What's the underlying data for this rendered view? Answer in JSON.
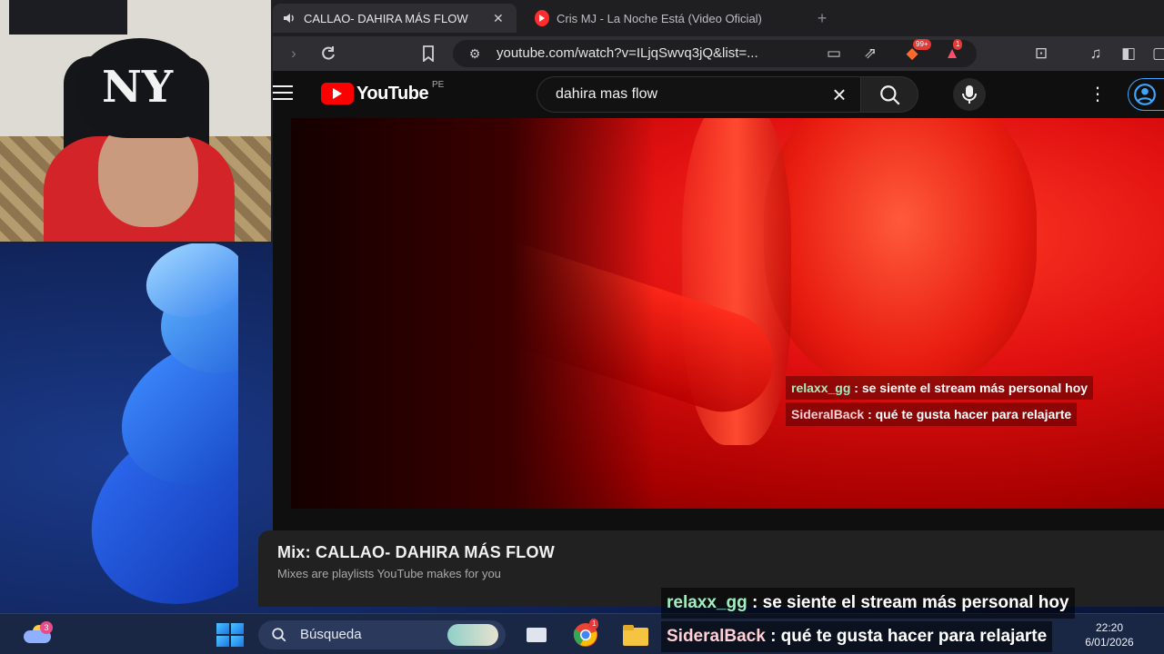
{
  "browser": {
    "tabs": [
      {
        "title": "CALLAO- DAHIRA MÁS FLOW",
        "active": true
      },
      {
        "title": "Cris MJ - La Noche Está (Video Oficial)",
        "active": false
      }
    ],
    "url": "youtube.com/watch?v=ILjqSwvq3jQ&list=...",
    "brave_badge": "99+",
    "ext_badge": "1"
  },
  "youtube": {
    "logo_text": "YouTube",
    "region": "PE",
    "search_query": "dahira mas flow"
  },
  "video_chat": [
    {
      "user": "relaxx_gg",
      "message": ": se siente el stream más personal hoy"
    },
    {
      "user": "SideralBack",
      "message": ": qué te gusta hacer para relajarte"
    }
  ],
  "playlist": {
    "title": "Mix: CALLAO- DAHIRA MÁS FLOW",
    "subtitle": "Mixes are playlists YouTube makes for you"
  },
  "stream_chat": [
    {
      "user": "relaxx_gg",
      "message": ": se siente el stream más personal hoy"
    },
    {
      "user": "SideralBack",
      "message": ": qué te gusta hacer para relajarte"
    }
  ],
  "taskbar": {
    "search_placeholder": "Búsqueda",
    "weather_badge": "3",
    "chrome_badge": "1",
    "time": "22:20",
    "date": "6/01/2026"
  },
  "webcam": {
    "cap_logo": "NY"
  },
  "colors": {
    "youtube_red": "#ff0000",
    "chat_user_green": "#9ef0bf",
    "taskbar": "#1a2744"
  }
}
